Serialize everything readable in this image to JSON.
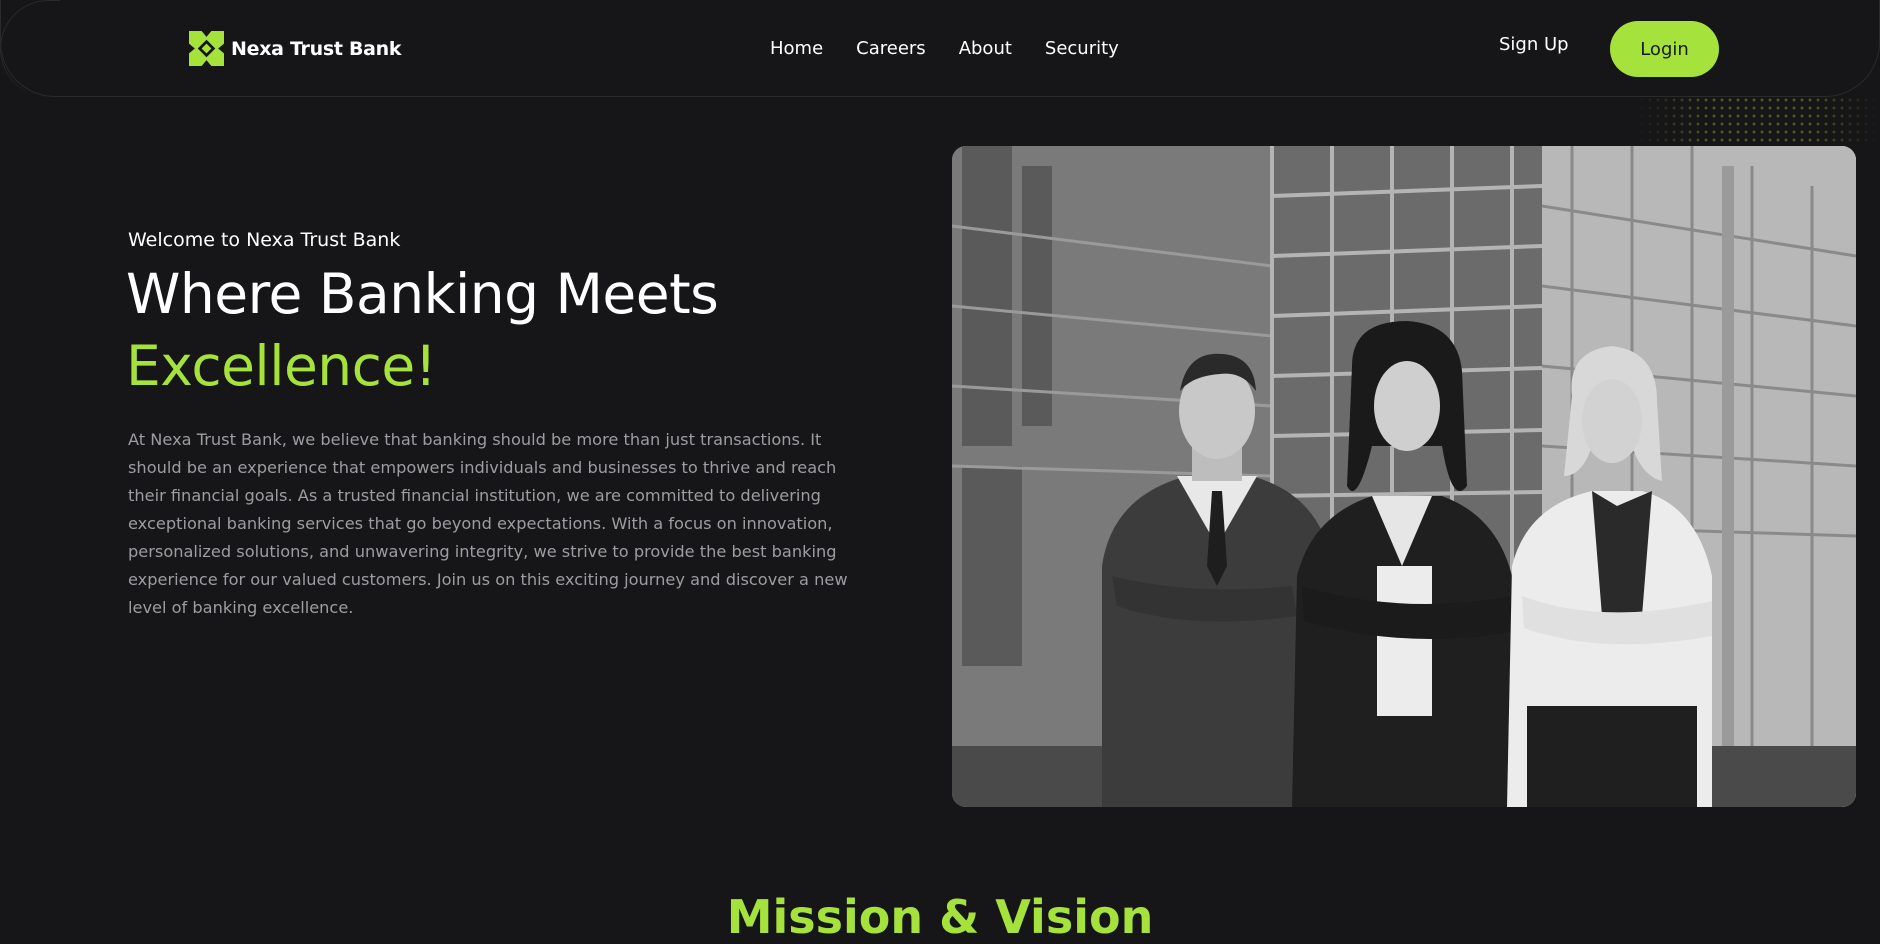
{
  "brand": {
    "name": "Nexa Trust Bank",
    "accent_color": "#a6e23c",
    "logo_icon": "x-diamond-logo-icon"
  },
  "nav": {
    "items": [
      {
        "label": "Home"
      },
      {
        "label": "Careers"
      },
      {
        "label": "About"
      },
      {
        "label": "Security"
      }
    ]
  },
  "auth": {
    "signup_label": "Sign Up",
    "login_label": "Login"
  },
  "hero": {
    "welcome": "Welcome to Nexa Trust Bank",
    "headline_line1": "Where Banking Meets",
    "headline_line2": "Excellence!",
    "intro": "At Nexa Trust Bank, we believe that banking should be more than just transactions. It should be an experience that empowers individuals and businesses to thrive and reach their financial goals. As a trusted financial institution, we are committed to delivering exceptional banking services that go beyond expectations. With a focus on innovation, personalized solutions, and unwavering integrity, we strive to provide the best banking experience for our valued customers. Join us on this exciting journey and discover a new level of banking excellence."
  },
  "sections": {
    "mission_title": "Mission & Vision"
  },
  "colors": {
    "background": "#161618",
    "accent": "#a6e23c",
    "body_text": "#9d9da1"
  }
}
